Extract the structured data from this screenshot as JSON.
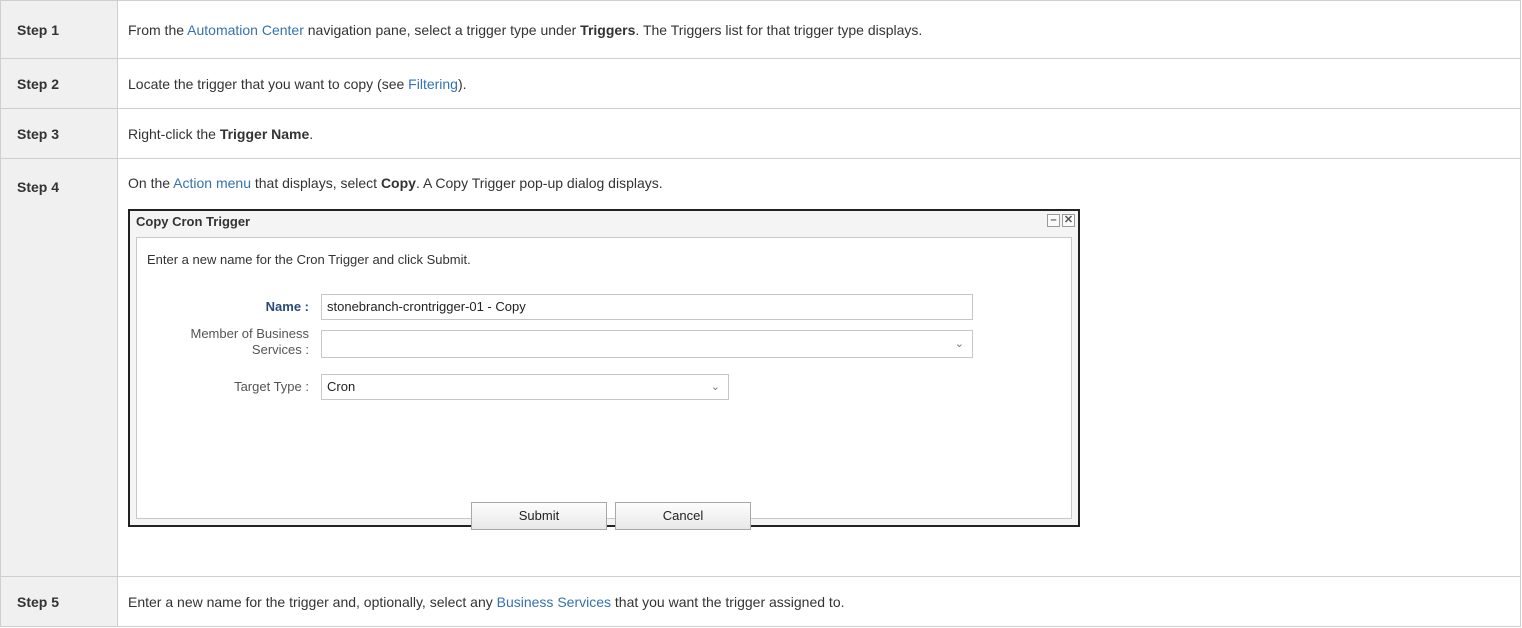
{
  "steps": [
    {
      "label": "Step 1",
      "t1": "From the ",
      "link1": "Automation Center",
      "t2": " navigation pane, select a trigger type under ",
      "bold1": "Triggers",
      "t3": ". The Triggers list for that trigger type displays."
    },
    {
      "label": "Step 2",
      "t1": "Locate the trigger that you want to copy (see ",
      "link1": "Filtering",
      "t2": ")."
    },
    {
      "label": "Step 3",
      "t1": "Right-click the ",
      "bold1": "Trigger Name",
      "t2": "."
    },
    {
      "label": "Step 4",
      "t1": "On the ",
      "link1": "Action menu",
      "t2": " that displays, select ",
      "bold1": "Copy",
      "t3": ". A Copy Trigger pop-up dialog displays."
    },
    {
      "label": "Step 5",
      "t1": "Enter a new name for the trigger and, optionally, select any ",
      "link1": "Business Services",
      "t2": " that you want the trigger assigned to."
    }
  ],
  "dialog": {
    "title": "Copy Cron Trigger",
    "minimize_glyph": "–",
    "close_glyph": "✕",
    "instruction": "Enter a new name for the Cron Trigger and click Submit.",
    "name_label": "Name :",
    "name_value": "stonebranch-crontrigger-01 - Copy",
    "member_label_line1": "Member of Business",
    "member_label_line2": "Services :",
    "member_value": "",
    "target_type_label": "Target Type :",
    "target_type_value": "Cron",
    "submit_label": "Submit",
    "cancel_label": "Cancel",
    "dropdown_glyph": "⌄"
  }
}
